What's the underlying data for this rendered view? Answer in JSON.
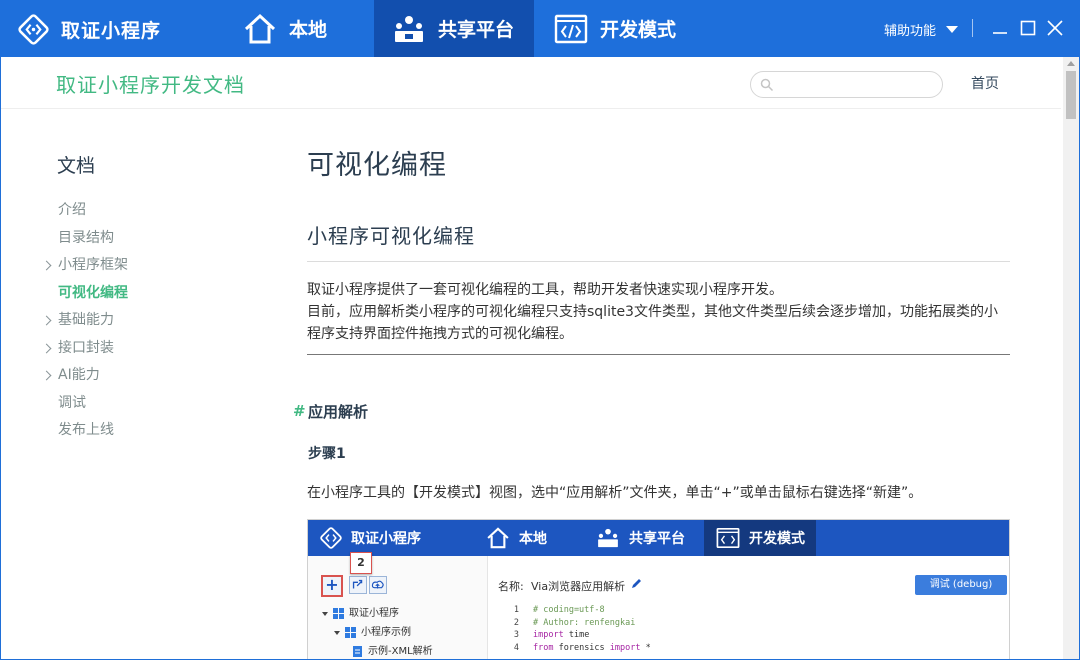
{
  "app": {
    "name": "取证小程序",
    "tabs": [
      {
        "label": "本地",
        "icon": "home-icon"
      },
      {
        "label": "共享平台",
        "icon": "share-platform-icon",
        "active": true
      },
      {
        "label": "开发模式",
        "icon": "code-icon"
      }
    ],
    "aux_menu": "辅助功能",
    "accent_color": "#1e6fdb",
    "active_tab_color": "#124fae"
  },
  "doc": {
    "site_title": "取证小程序开发文档",
    "search": {
      "value": "",
      "placeholder": ""
    },
    "home_link": "首页",
    "accent_color": "#42b983"
  },
  "sidebar": {
    "heading": "文档",
    "items": [
      {
        "label": "介绍",
        "expandable": false,
        "active": false
      },
      {
        "label": "目录结构",
        "expandable": false,
        "active": false
      },
      {
        "label": "小程序框架",
        "expandable": true,
        "active": false
      },
      {
        "label": "可视化编程",
        "expandable": false,
        "active": true
      },
      {
        "label": "基础能力",
        "expandable": true,
        "active": false
      },
      {
        "label": "接口封装",
        "expandable": true,
        "active": false
      },
      {
        "label": "AI能力",
        "expandable": true,
        "active": false
      },
      {
        "label": "调试",
        "expandable": false,
        "active": false
      },
      {
        "label": "发布上线",
        "expandable": false,
        "active": false
      }
    ]
  },
  "article": {
    "h1": "可视化编程",
    "h2": "小程序可视化编程",
    "para_line1": "取证小程序提供了一套可视化编程的工具，帮助开发者快速实现小程序开发。",
    "para_line2": "目前，应用解析类小程序的可视化编程只支持sqlite3文件类型，其他文件类型后续会逐步增加，功能拓展类的小程序支持界面控件拖拽方式的可视化编程。",
    "anchor": "#",
    "h3": "应用解析",
    "h4": "步骤1",
    "step_text": "在小程序工具的【开发模式】视图，选中“应用解析”文件夹，单击“+”或单击鼠标右键选择“新建”。"
  },
  "screenshot": {
    "brand": "取证小程序",
    "tabs": [
      "本地",
      "共享平台",
      "开发模式"
    ],
    "callout": "2",
    "add_button": "+",
    "tree": [
      "取证小程序",
      "小程序示例",
      "示例-XML解析"
    ],
    "name_label": "名称:",
    "name_value": "Via浏览器应用解析",
    "debug_button": "调试 (debug)",
    "code": [
      {
        "ln": "1",
        "parts": [
          {
            "t": "cm",
            "s": "# coding=utf-8"
          }
        ]
      },
      {
        "ln": "2",
        "parts": [
          {
            "t": "cm",
            "s": "# Author: renfengkai"
          }
        ]
      },
      {
        "ln": "3",
        "parts": [
          {
            "t": "kw",
            "s": "import"
          },
          {
            "t": "tx",
            "s": " time"
          }
        ]
      },
      {
        "ln": "4",
        "parts": [
          {
            "t": "kw",
            "s": "from"
          },
          {
            "t": "tx",
            "s": " forensics "
          },
          {
            "t": "kw",
            "s": "import"
          },
          {
            "t": "tx",
            "s": " *"
          }
        ]
      }
    ]
  }
}
